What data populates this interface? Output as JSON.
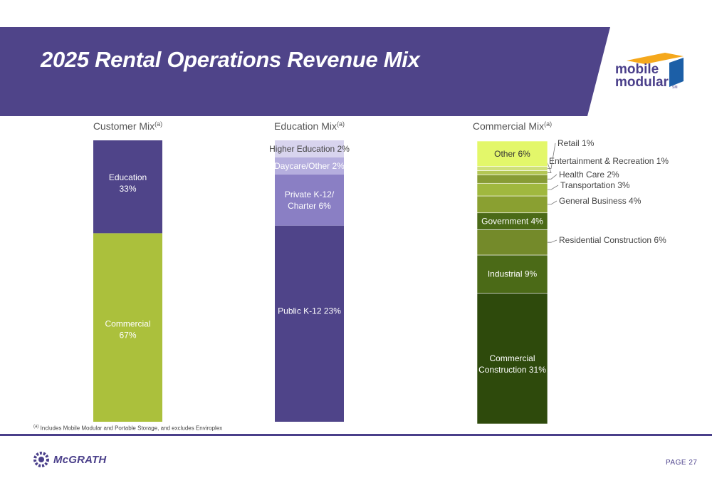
{
  "title": "2025 Rental Operations Revenue Mix",
  "logo": {
    "line1": "mobile",
    "line2": "modular",
    "tm": "SM"
  },
  "footnote": {
    "marker": "(a)",
    "text": "Includes Mobile Modular and Portable Storage, and excludes Enviroplex"
  },
  "footer": {
    "brand": "McGRATH",
    "page": "PAGE 27"
  },
  "colors": {
    "banner": "#4f4489",
    "footer_line": "#4a3f8a",
    "logo_orange": "#f5a81c",
    "logo_blue": "#1c5fa7"
  },
  "chart_data": [
    {
      "type": "bar",
      "stacked": true,
      "title": "Customer Mix",
      "title_note": "(a)",
      "unit": "%",
      "series": [
        {
          "name": "Commercial",
          "label": "67%",
          "value": 67,
          "color": "#abc03c",
          "text_color": "#ffffff"
        },
        {
          "name": "Education",
          "label": "33%",
          "value": 33,
          "color": "#4f4489",
          "text_color": "#ffffff"
        }
      ]
    },
    {
      "type": "bar",
      "stacked": true,
      "title": "Education Mix",
      "title_note": "(a)",
      "unit": "%",
      "series": [
        {
          "name": "Public K-12",
          "label": "23%",
          "value": 23,
          "color": "#4f4489",
          "text_color": "#ffffff"
        },
        {
          "name": "Private K-12/",
          "name2": "Charter",
          "label": "6%",
          "value": 6,
          "color": "#8a7fc4",
          "text_color": "#ffffff"
        },
        {
          "name": "Daycare/Other",
          "label": "2%",
          "value": 2,
          "color": "#b5aede",
          "text_color": "#ffffff"
        },
        {
          "name": "Higher Education",
          "label": "2%",
          "value": 2,
          "color": "#d8d4ee",
          "text_color": "#444444"
        }
      ]
    },
    {
      "type": "bar",
      "stacked": true,
      "title": "Commercial Mix",
      "title_note": "(a)",
      "unit": "%",
      "series": [
        {
          "name": "Commercial",
          "name2": "Construction",
          "label": "31%",
          "value": 31,
          "color": "#2e4a0c",
          "text_color": "#ffffff",
          "placement": "inside"
        },
        {
          "name": "Industrial",
          "label": "9%",
          "value": 9,
          "color": "#4b6a17",
          "text_color": "#ffffff",
          "placement": "inside"
        },
        {
          "name": "Residential Construction",
          "label": "6%",
          "value": 6,
          "color": "#748a2a",
          "placement": "outside"
        },
        {
          "name": "Government",
          "label": "4%",
          "value": 4,
          "color": "#4b6a17",
          "text_color": "#ffffff",
          "placement": "inside"
        },
        {
          "name": "General Business",
          "label": "4%",
          "value": 4,
          "color": "#8aa031",
          "placement": "outside"
        },
        {
          "name": "Transportation",
          "label": "3%",
          "value": 3,
          "color": "#a0b83e",
          "placement": "outside"
        },
        {
          "name": "Health Care",
          "label": "2%",
          "value": 2,
          "color": "#889c35",
          "placement": "outside"
        },
        {
          "name": "Entertainment & Recreation",
          "label": "1%",
          "value": 1,
          "color": "#b3c654",
          "placement": "outside"
        },
        {
          "name": "Retail",
          "label": "1%",
          "value": 1,
          "color": "#cfe07a",
          "placement": "outside"
        },
        {
          "name": "Other",
          "label": "6%",
          "value": 6,
          "color": "#e3f76a",
          "text_color": "#333333",
          "placement": "inside"
        }
      ]
    }
  ]
}
